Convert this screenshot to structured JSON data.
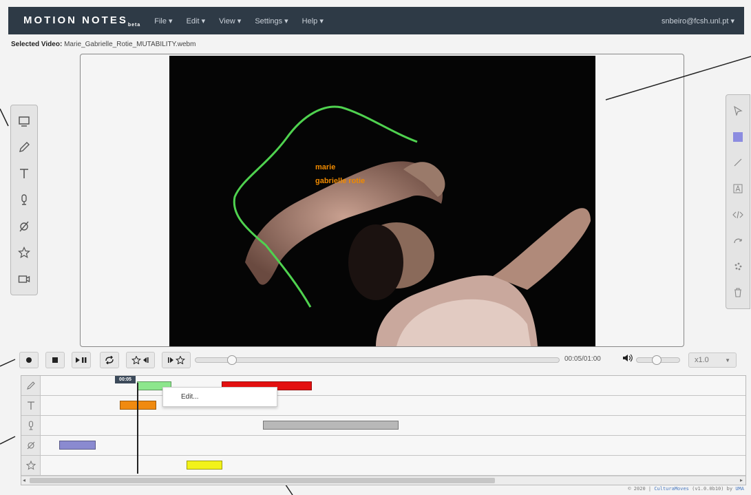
{
  "app": {
    "brand": "MOTION NOTES",
    "brand_suffix": "beta",
    "menu": [
      "File ▾",
      "Edit ▾",
      "View ▾",
      "Settings ▾",
      "Help ▾"
    ],
    "user": "snbeiro@fcsh.unl.pt ▾"
  },
  "selected_video": {
    "label": "Selected Video:",
    "value": "Marie_Gabrielle_Rotie_MUTABILITY.webm"
  },
  "video": {
    "annotation_text_1": "marie",
    "annotation_text_2": "gabrielle rotie",
    "annotation_color": "#f08a00",
    "sketch_color": "#4fd24f"
  },
  "left_toolbar": [
    "rectangle-icon",
    "pen-icon",
    "text-icon",
    "mic-icon",
    "path-icon",
    "star-icon",
    "camera-icon"
  ],
  "right_toolbar": [
    "cursor-icon",
    "fill-color-icon",
    "line-icon",
    "text-box-icon",
    "code-icon",
    "redo-icon",
    "palette-icon",
    "trash-icon"
  ],
  "playback": {
    "time": "00:05/01:00",
    "speed": "x1.0",
    "seek_progress": 0.1,
    "volume_level": 0.45
  },
  "timeline": {
    "playhead_label": "00:05",
    "tracks": [
      "pen",
      "text",
      "audio",
      "path",
      "star"
    ],
    "context_menu_item": "Edit..."
  },
  "footer": {
    "copy": "© 2020 |",
    "link": "CulturaMoves",
    "version": "(v1.0.0b10) by",
    "author": "UMA"
  },
  "colors": {
    "navbar": "#2e3a46",
    "clip_green": "#8de68d",
    "clip_red": "#e31010",
    "clip_orange": "#f08a10",
    "clip_gray": "#b8b8b8",
    "clip_purple": "#8a8ad0",
    "clip_yellow": "#f2f21a"
  }
}
